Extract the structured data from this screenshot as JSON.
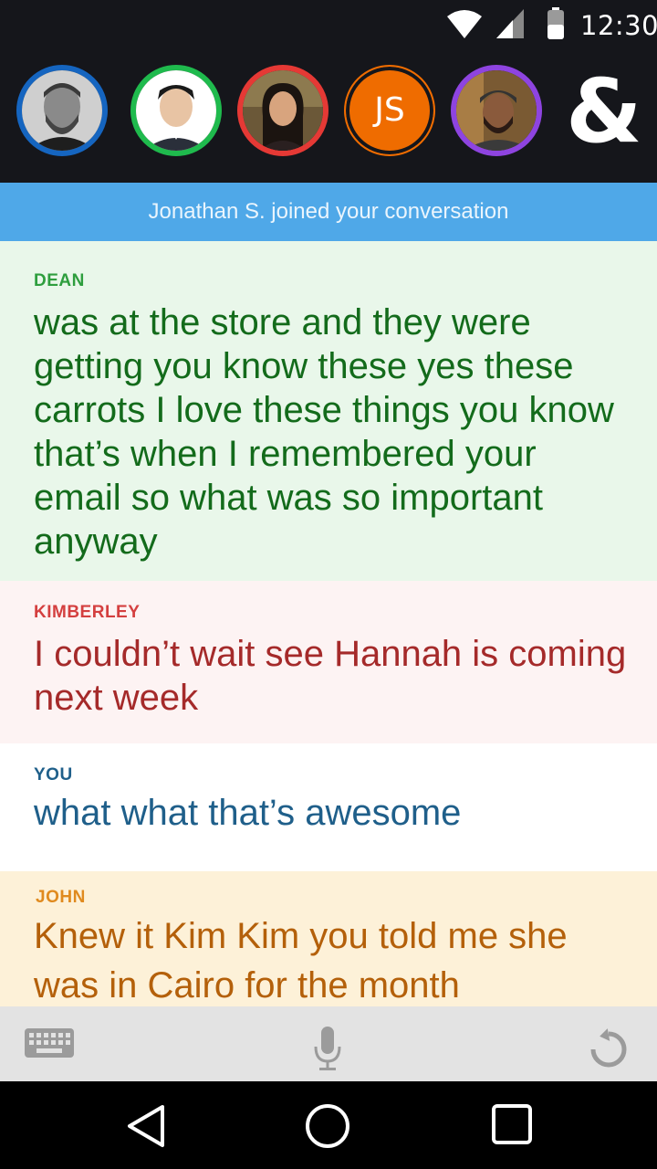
{
  "status_bar": {
    "time": "12:30",
    "icons": [
      "wifi-icon",
      "cell-signal-icon",
      "battery-icon"
    ]
  },
  "participants": [
    {
      "name": "participant-1",
      "ring_color": "#1565c0"
    },
    {
      "name": "participant-2",
      "ring_color": "#1fba4d"
    },
    {
      "name": "participant-3",
      "ring_color": "#e53935"
    },
    {
      "name": "participant-js",
      "initials": "JS",
      "ring_color": "#ef6c00"
    },
    {
      "name": "participant-5",
      "ring_color": "#8e44e0"
    }
  ],
  "header": {
    "ampersand": "&"
  },
  "notice": {
    "text": "Jonathan S. joined your conversation"
  },
  "messages": [
    {
      "sender": "DEAN",
      "text": "was at the store and they were getting you know these yes these carrots I love these things you know that’s when I remembered your email so what was so important anyway",
      "color": "#136b1b"
    },
    {
      "sender": "KIMBERLEY",
      "text": "I couldn’t wait see Hannah is coming next week",
      "color": "#a52a2a"
    },
    {
      "sender": "YOU",
      "text": "what what that’s awesome",
      "color": "#1f5f8a"
    },
    {
      "sender": "JOHN",
      "text": "Knew it Kim Kim you told me she was in Cairo for the month",
      "color": "#b4600a"
    }
  ],
  "input_bar": {
    "icons": [
      "keyboard-icon",
      "microphone-icon",
      "undo-icon"
    ]
  },
  "nav_bar": {
    "icons": [
      "back-icon",
      "home-icon",
      "recents-icon"
    ]
  }
}
